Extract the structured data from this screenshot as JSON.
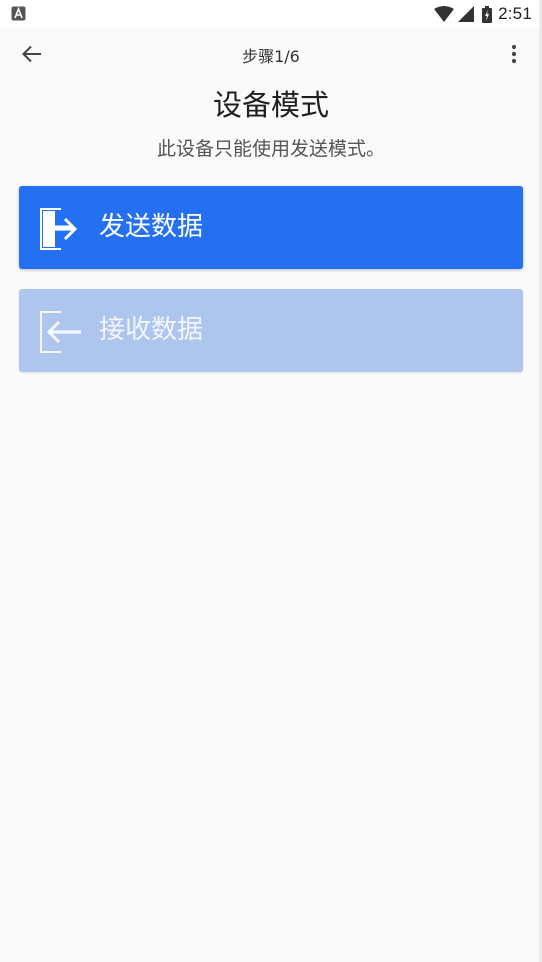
{
  "status_bar": {
    "time": "2:51",
    "left_icon": "a-icon",
    "icons": [
      "wifi-icon",
      "signal-icon",
      "battery-icon"
    ]
  },
  "app_bar": {
    "step": "步骤1/6",
    "back_icon": "arrow-left-icon",
    "more_icon": "more-vert-icon"
  },
  "main": {
    "title": "设备模式",
    "subtitle": "此设备只能使用发送模式。",
    "modes": [
      {
        "label": "发送数据",
        "icon": "send-data-icon",
        "enabled": true,
        "color": "#2470f0"
      },
      {
        "label": "接收数据",
        "icon": "receive-data-icon",
        "enabled": false,
        "color": "#aec5ee"
      }
    ]
  }
}
